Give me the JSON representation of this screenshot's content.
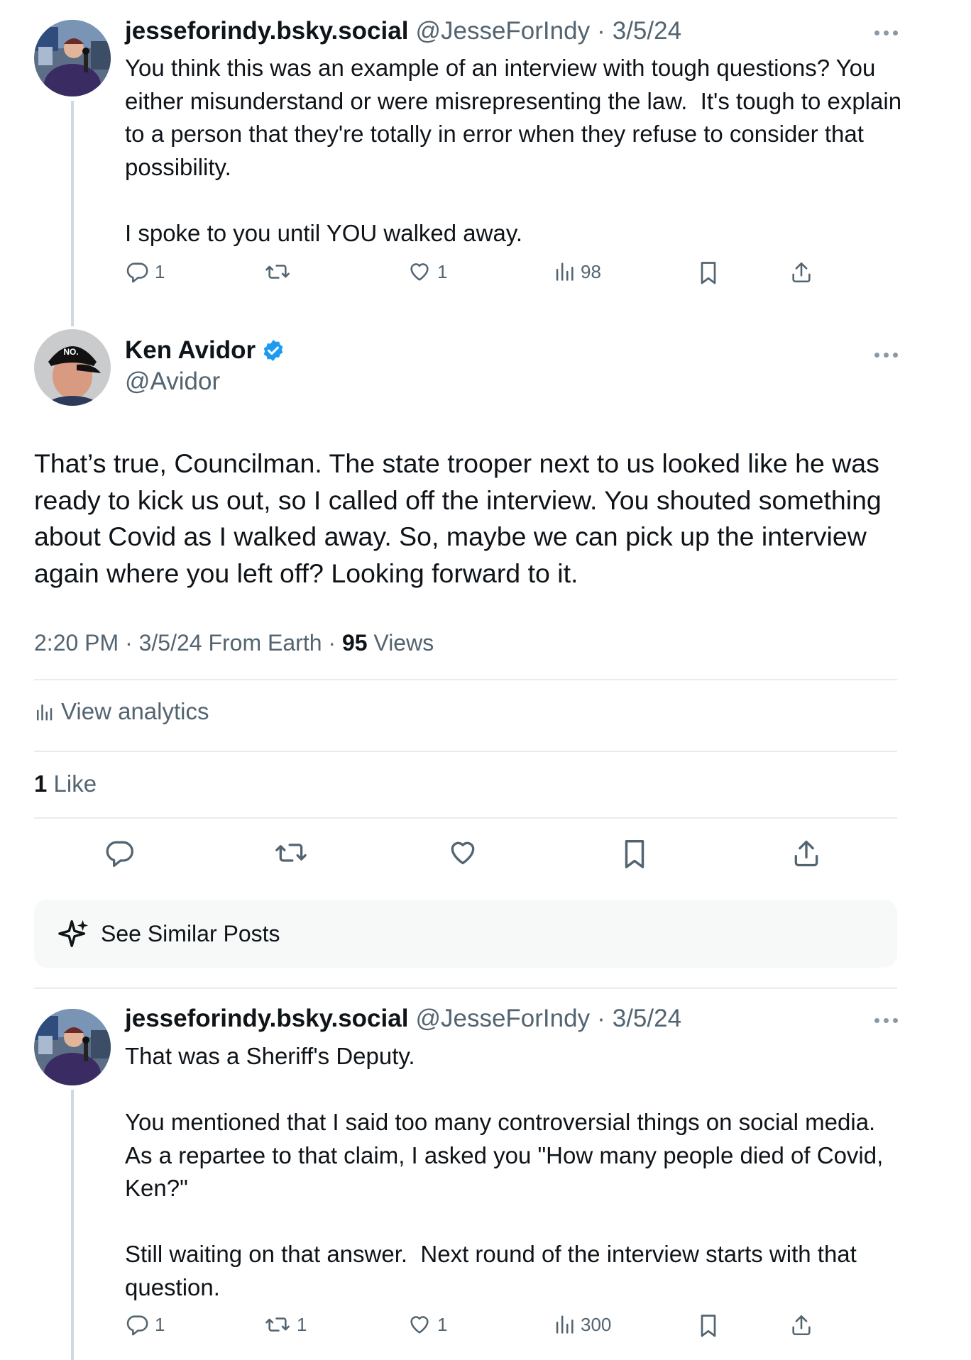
{
  "post1": {
    "display_name": "jesseforindy.bsky.social",
    "handle": "@JesseForIndy",
    "separator": "·",
    "date": "3/5/24",
    "text": "You think this was an example of an interview with tough questions? You either misunderstand or were misrepresenting the law.  It's tough to explain to a person that they're totally in error when they refuse to consider that possibility.\n\nI spoke to you until YOU walked away.",
    "replies": "1",
    "reposts": "",
    "likes": "1",
    "views": "98"
  },
  "main_post": {
    "display_name": "Ken Avidor",
    "handle": "@Avidor",
    "verified": true,
    "avatar_cap_text": "NO.",
    "text": "That’s true, Councilman. The state trooper next to us looked like he was ready to kick us out, so I called off the interview. You shouted something about Covid as I walked away. So, maybe we can pick up the interview again where you left off? Looking forward to it.",
    "time": "2:20 PM",
    "date": "3/5/24",
    "source": "From Earth",
    "views_count": "95",
    "views_label": "Views",
    "analytics_label": "View analytics",
    "likes_count": "1",
    "likes_label": "Like",
    "similar_label": "See Similar Posts"
  },
  "post3": {
    "display_name": "jesseforindy.bsky.social",
    "handle": "@JesseForIndy",
    "separator": "·",
    "date": "3/5/24",
    "text": "That was a Sheriff's Deputy.\n\nYou mentioned that I said too many controversial things on social media.  As a repartee to that claim, I asked you \"How many people died of Covid, Ken?\"\n\nStill waiting on that answer.  Next round of the interview starts with that question.",
    "replies": "1",
    "reposts": "1",
    "likes": "1",
    "views": "300"
  },
  "colors": {
    "text": "#0f1419",
    "secondary": "#536471",
    "verified": "#1d9bf0",
    "divider": "#e7ecf0",
    "card_bg": "#f7f9f9"
  },
  "icons": [
    "reply-icon",
    "repost-icon",
    "like-icon",
    "views-icon",
    "bookmark-icon",
    "share-icon",
    "more-icon",
    "verified-icon",
    "sparkle-icon",
    "analytics-icon"
  ]
}
